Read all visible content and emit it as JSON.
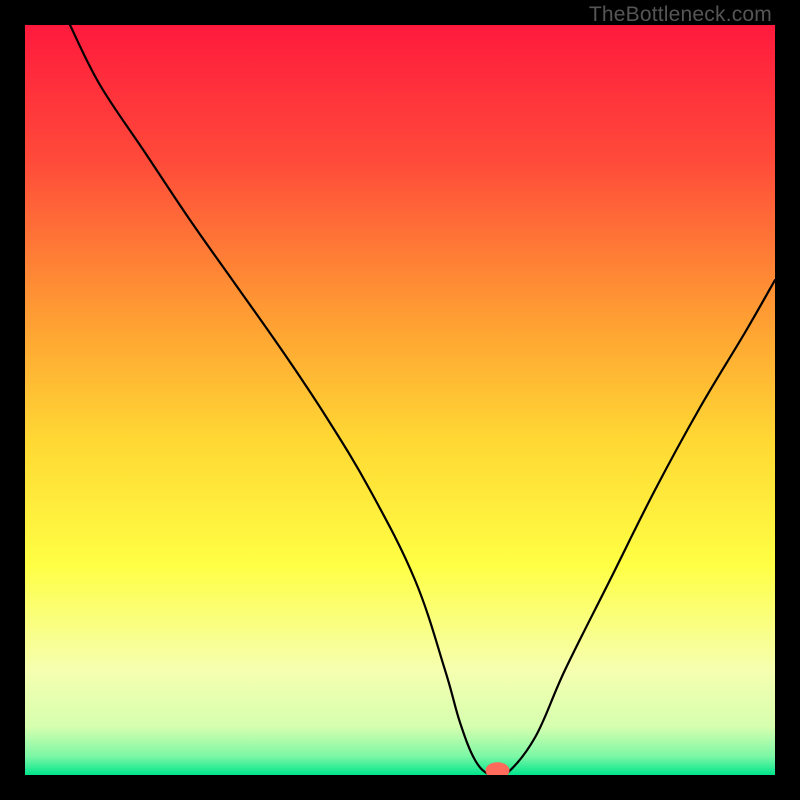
{
  "watermark": "TheBottleneck.com",
  "chart_data": {
    "type": "line",
    "title": "",
    "xlabel": "",
    "ylabel": "",
    "xlim": [
      0,
      100
    ],
    "ylim": [
      0,
      100
    ],
    "grid": false,
    "legend": false,
    "background_gradient_stops": [
      {
        "pos": 0.0,
        "color": "#ff1a3d"
      },
      {
        "pos": 0.18,
        "color": "#ff4a3a"
      },
      {
        "pos": 0.38,
        "color": "#ff9a33"
      },
      {
        "pos": 0.55,
        "color": "#ffd733"
      },
      {
        "pos": 0.72,
        "color": "#ffff44"
      },
      {
        "pos": 0.86,
        "color": "#f6ffb0"
      },
      {
        "pos": 0.935,
        "color": "#d6ffaf"
      },
      {
        "pos": 0.975,
        "color": "#7df7a6"
      },
      {
        "pos": 1.0,
        "color": "#00e58c"
      }
    ],
    "series": [
      {
        "name": "bottleneck-curve",
        "color": "#000000",
        "width": 2.2,
        "x": [
          6,
          10,
          16,
          22,
          28,
          34,
          40,
          46,
          52,
          56,
          58,
          60,
          62,
          64,
          68,
          72,
          78,
          84,
          90,
          96,
          100
        ],
        "y": [
          100,
          92,
          83,
          74,
          65.5,
          57,
          48,
          38,
          26,
          14,
          7,
          2,
          0,
          0,
          5,
          14,
          26,
          38,
          49,
          59,
          66
        ]
      }
    ],
    "marker": {
      "name": "optimal-point",
      "x": 63,
      "y": 0.6,
      "color": "#ff6a5a",
      "rx": 1.6,
      "ry": 1.1
    }
  }
}
